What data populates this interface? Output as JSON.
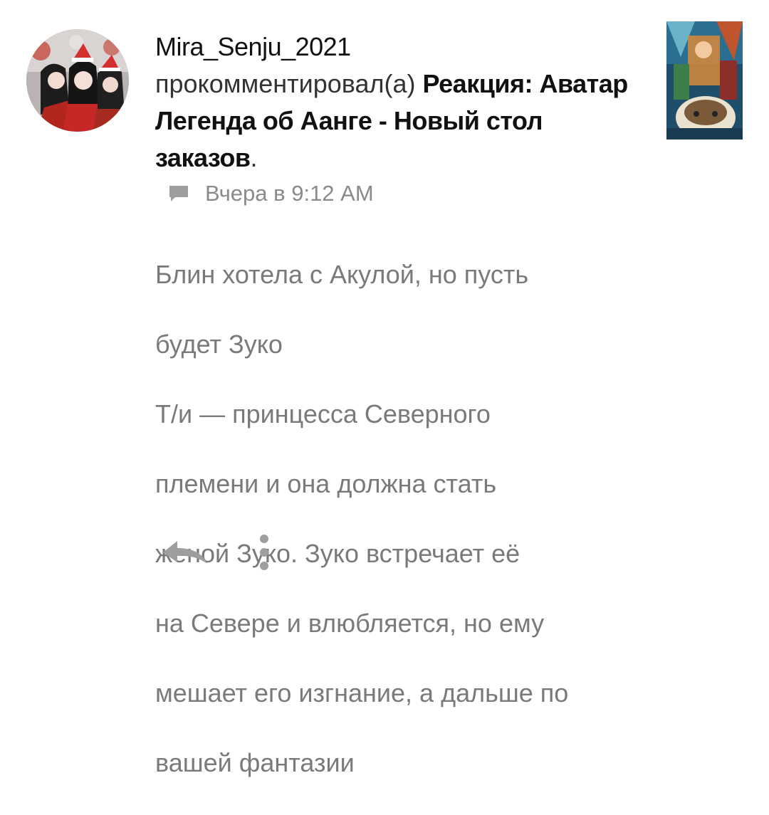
{
  "comment": {
    "username": "Mira_Senju_2021",
    "action_text": "прокомментировал(а)",
    "post_title": "Реакция: Аватар Легенда об Аанге - Новый стол заказов",
    "post_title_suffix": ".",
    "timestamp": "Вчера в 9:12 AM",
    "body_lines": [
      "Блин хотела с Акулой, но пусть",
      "будет Зуко",
      "Т/и — принцесса Северного",
      "племени и она должна стать",
      "женой Зуко. Зуко встречает её",
      "на Севере и влюбляется, но ему",
      "мешает его изгнание, а дальше по",
      "вашей фантазии"
    ]
  },
  "icons": {
    "timestamp_icon": "comment-bubble-icon",
    "reply_icon": "reply-arrow-icon",
    "more_icon": "more-vertical-icon"
  },
  "colors": {
    "username": "#111111",
    "body_text": "#7a7a7a",
    "meta_text": "#8a8a8a",
    "icon_gray": "#9e9e9e"
  }
}
